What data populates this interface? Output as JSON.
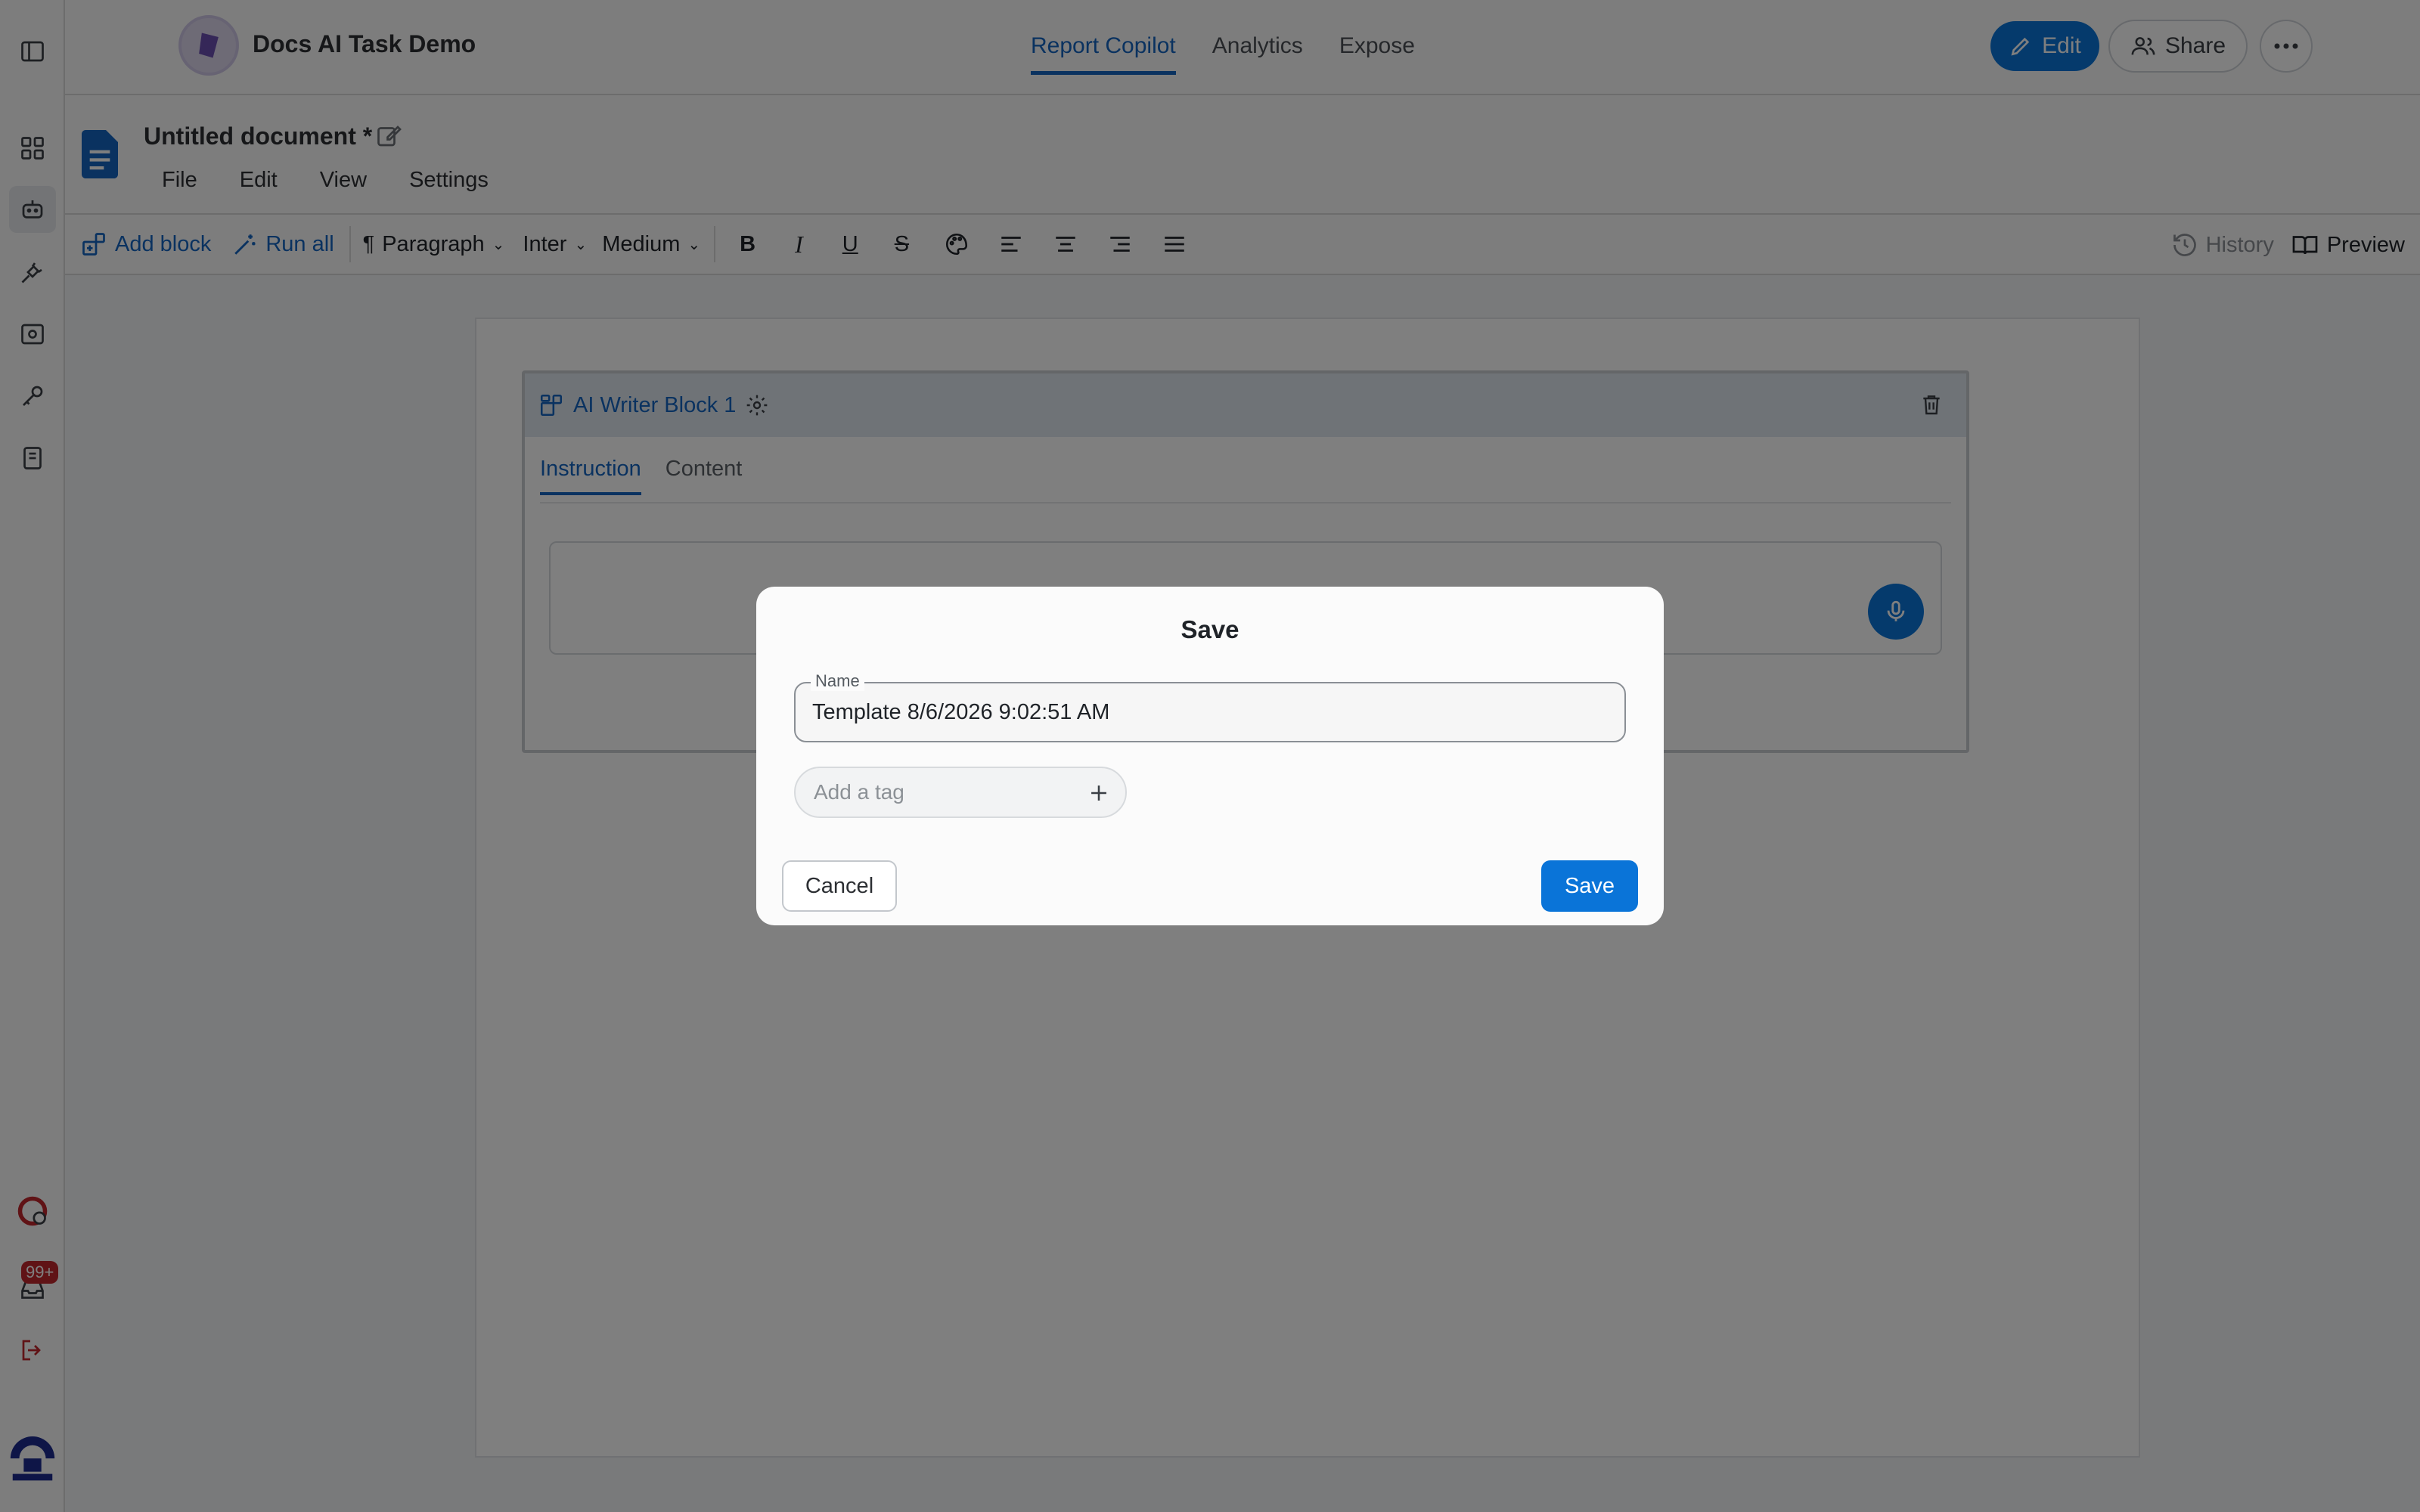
{
  "header": {
    "app_title": "Docs AI Task Demo",
    "tabs": [
      {
        "label": "Report Copilot",
        "active": true
      },
      {
        "label": "Analytics",
        "active": false
      },
      {
        "label": "Expose",
        "active": false
      }
    ],
    "edit_label": "Edit",
    "share_label": "Share"
  },
  "rail": {
    "notification_count": "99+"
  },
  "document": {
    "title": "Untitled document *",
    "menu": [
      "File",
      "Edit",
      "View",
      "Settings"
    ]
  },
  "toolbar": {
    "add_block": "Add block",
    "run_all": "Run all",
    "paragraph": "Paragraph",
    "font": "Inter",
    "weight": "Medium",
    "history": "History",
    "preview": "Preview"
  },
  "block": {
    "title": "AI Writer Block 1",
    "tabs": [
      "Instruction",
      "Content"
    ],
    "active_tab": "Instruction"
  },
  "modal": {
    "title": "Save",
    "name_label": "Name",
    "name_value": "Template 8/6/2026 9:02:51 AM",
    "tag_placeholder": "Add a tag",
    "cancel_label": "Cancel",
    "save_label": "Save"
  },
  "colors": {
    "accent": "#0a74d8",
    "link": "#1565c0",
    "badge": "#c0262d"
  }
}
